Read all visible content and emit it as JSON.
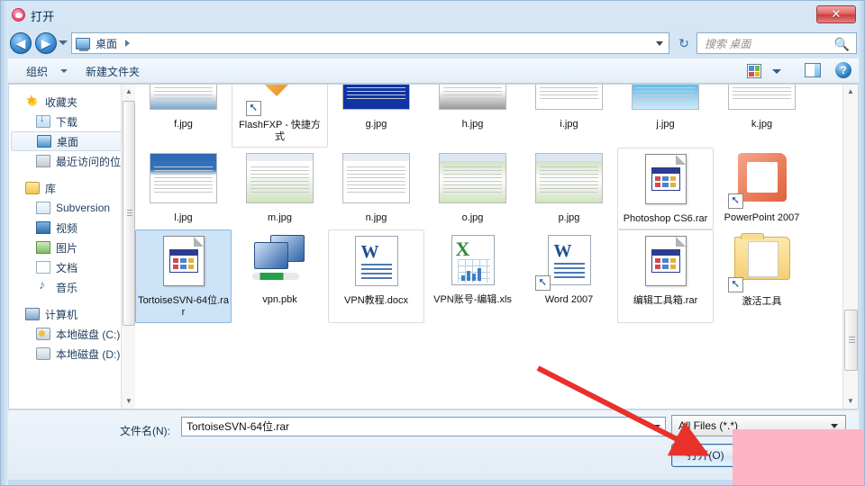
{
  "window": {
    "title": "打开",
    "app_icon": "heart-circle-icon",
    "close_label": "✕"
  },
  "address_bar": {
    "back_glyph": "◀",
    "forward_glyph": "▶",
    "crumb": "桌面",
    "separator_glyph": "▶",
    "refresh_glyph": "↻",
    "dropdown_glyph": "▼"
  },
  "search": {
    "placeholder": "搜索 桌面",
    "icon_glyph": "🔍"
  },
  "toolbar": {
    "organize_label": "组织",
    "new_folder_label": "新建文件夹",
    "views_icon": "views-grid-icon",
    "preview_icon": "preview-pane-icon",
    "help_glyph": "?"
  },
  "sidebar": {
    "groups": [
      {
        "head": "收藏夹",
        "head_icon": "star-icon",
        "items": [
          {
            "label": "下载",
            "icon": "downloads-icon",
            "selected": false
          },
          {
            "label": "桌面",
            "icon": "desktop-icon",
            "selected": true
          },
          {
            "label": "最近访问的位置",
            "icon": "recent-places-icon",
            "selected": false
          }
        ]
      },
      {
        "head": "库",
        "head_icon": "library-icon",
        "items": [
          {
            "label": "Subversion",
            "icon": "subversion-icon",
            "selected": false
          },
          {
            "label": "视频",
            "icon": "video-icon",
            "selected": false
          },
          {
            "label": "图片",
            "icon": "pictures-icon",
            "selected": false
          },
          {
            "label": "文档",
            "icon": "documents-icon",
            "selected": false
          },
          {
            "label": "音乐",
            "icon": "music-icon",
            "selected": false
          }
        ]
      },
      {
        "head": "计算机",
        "head_icon": "computer-icon",
        "items": [
          {
            "label": "本地磁盘 (C:)",
            "icon": "disk-c-icon",
            "selected": false
          },
          {
            "label": "本地磁盘 (D:)",
            "icon": "disk-d-icon",
            "selected": false
          }
        ]
      }
    ]
  },
  "files": {
    "rows": [
      [
        {
          "label": "f.jpg",
          "kind": "shot-dark",
          "selected": false,
          "shortcut": false
        },
        {
          "label": "FlashFXP - 快捷方式",
          "kind": "flashfxp",
          "selected": false,
          "shortcut": true,
          "hovered": true
        },
        {
          "label": "g.jpg",
          "kind": "shot-blue",
          "selected": false,
          "shortcut": false
        },
        {
          "label": "h.jpg",
          "kind": "shot-gray",
          "selected": false,
          "shortcut": false
        },
        {
          "label": "i.jpg",
          "kind": "shot-white",
          "selected": false,
          "shortcut": false
        },
        {
          "label": "j.jpg",
          "kind": "shot-cyan",
          "selected": false,
          "shortcut": false
        },
        {
          "label": "k.jpg",
          "kind": "shot-desktop",
          "selected": false,
          "shortcut": false
        }
      ],
      [
        {
          "label": "l.jpg",
          "kind": "shot-desktop",
          "selected": false,
          "shortcut": false
        },
        {
          "label": "m.jpg",
          "kind": "shot-green",
          "selected": false,
          "shortcut": false
        },
        {
          "label": "n.jpg",
          "kind": "shot-dialog",
          "selected": false,
          "shortcut": false
        },
        {
          "label": "o.jpg",
          "kind": "shot-green2",
          "selected": false,
          "shortcut": false
        },
        {
          "label": "p.jpg",
          "kind": "shot-green2",
          "selected": false,
          "shortcut": false
        },
        {
          "label": "Photoshop CS6.rar",
          "kind": "rar",
          "selected": false,
          "shortcut": false,
          "hovered": true
        },
        {
          "label": "PowerPoint 2007",
          "kind": "ppt",
          "selected": false,
          "shortcut": true
        }
      ],
      [
        {
          "label": "TortoiseSVN-64位.rar",
          "kind": "rar",
          "selected": true,
          "shortcut": false
        },
        {
          "label": "vpn.pbk",
          "kind": "pbk",
          "selected": false,
          "shortcut": false
        },
        {
          "label": "VPN教程.docx",
          "kind": "word-doc",
          "selected": false,
          "shortcut": false,
          "hovered": true
        },
        {
          "label": "VPN账号-编辑.xls",
          "kind": "excel",
          "selected": false,
          "shortcut": false
        },
        {
          "label": "Word 2007",
          "kind": "word-app",
          "selected": false,
          "shortcut": true
        },
        {
          "label": "编辑工具箱.rar",
          "kind": "rar",
          "selected": false,
          "shortcut": false,
          "hovered": true
        },
        {
          "label": "激活工具",
          "kind": "folder",
          "selected": false,
          "shortcut": true
        }
      ]
    ]
  },
  "bottom": {
    "filename_label": "文件名(N):",
    "filename_value": "TortoiseSVN-64位.rar",
    "filter_value": "All Files (*.*)",
    "open_label": "打开(O)",
    "cancel_label": ""
  },
  "annotations": {
    "arrow_color": "#e8312a",
    "overlay_color": "#ffb3c6"
  }
}
